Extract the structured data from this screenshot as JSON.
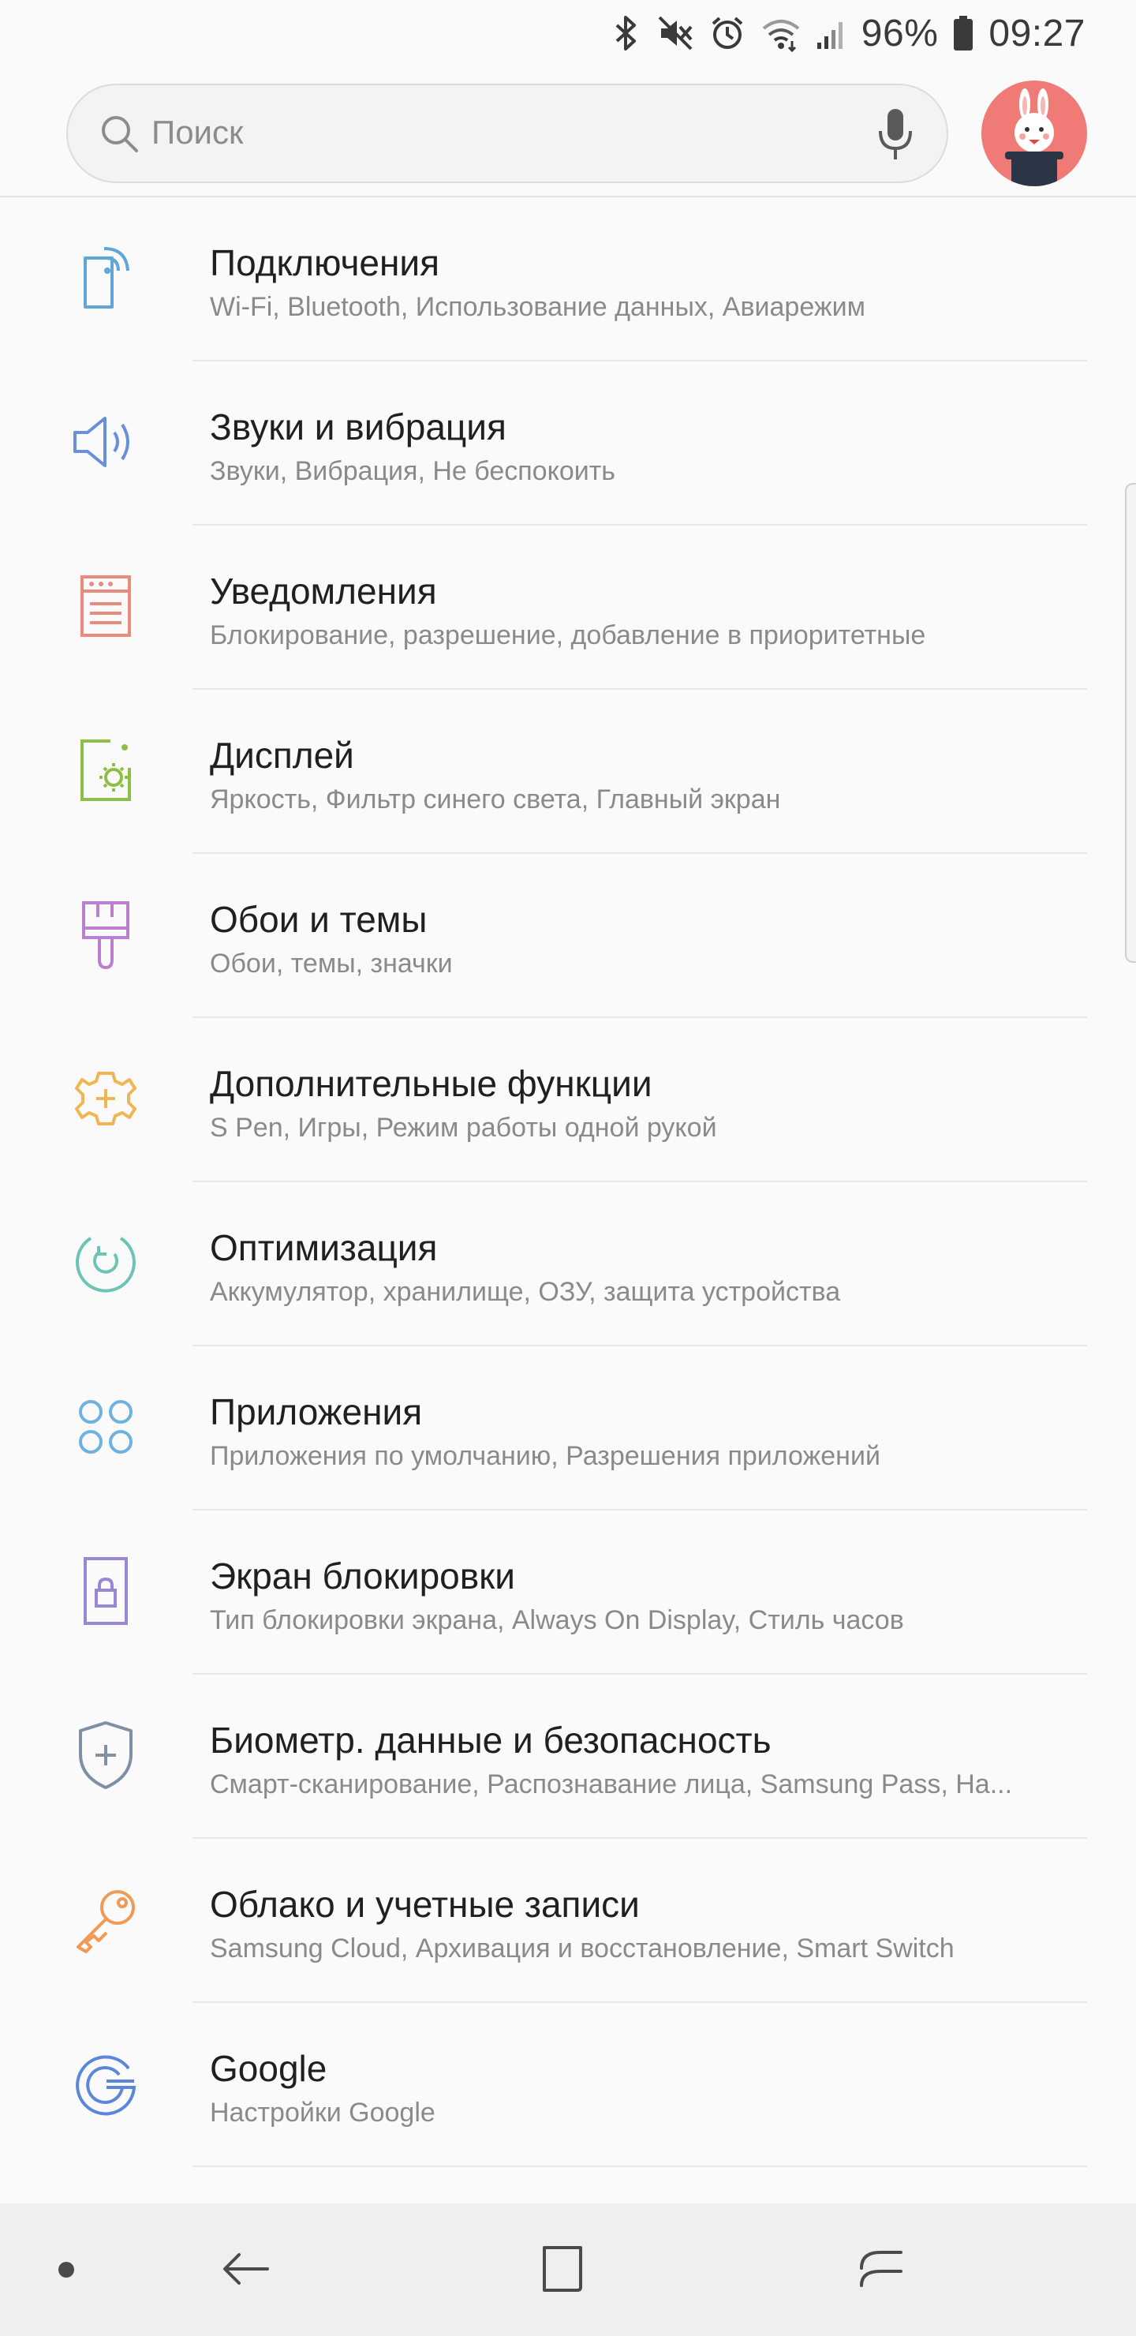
{
  "status_bar": {
    "battery": "96%",
    "time": "09:27",
    "icons": [
      "bluetooth-icon",
      "mute-icon",
      "alarm-icon",
      "wifi-icon",
      "signal-icon",
      "battery-icon"
    ]
  },
  "search": {
    "placeholder": "Поиск",
    "icons": [
      "search-icon",
      "mic-icon"
    ]
  },
  "accent_colors": {
    "connections": "#5fa6d9",
    "sounds": "#6a8fd8",
    "notifications": "#ea8b7d",
    "display": "#8cbf45",
    "wallpaper": "#bb7fd0",
    "advanced": "#f0b654",
    "optimization": "#6ec4b4",
    "apps": "#6fb2e0",
    "lock": "#9a86d6",
    "biometrics": "#7f8fa4",
    "cloud": "#f09a55",
    "google": "#5b87db"
  },
  "settings": [
    {
      "title": "Подключения",
      "subtitle": "Wi-Fi, Bluetooth, Использование данных, Авиарежим",
      "icon": "connections-icon"
    },
    {
      "title": "Звуки и вибрация",
      "subtitle": "Звуки, Вибрация, Не беспокоить",
      "icon": "speaker-icon"
    },
    {
      "title": "Уведомления",
      "subtitle": "Блокирование, разрешение, добавление в приоритетные",
      "icon": "notifications-icon"
    },
    {
      "title": "Дисплей",
      "subtitle": "Яркость, Фильтр синего света, Главный экран",
      "icon": "display-brightness-icon"
    },
    {
      "title": "Обои и темы",
      "subtitle": "Обои, темы, значки",
      "icon": "paintbrush-icon"
    },
    {
      "title": "Дополнительные функции",
      "subtitle": "S Pen, Игры, Режим работы одной рукой",
      "icon": "gear-plus-icon"
    },
    {
      "title": "Оптимизация",
      "subtitle": "Аккумулятор, хранилище, ОЗУ, защита устройства",
      "icon": "optimization-icon"
    },
    {
      "title": "Приложения",
      "subtitle": "Приложения по умолчанию, Разрешения приложений",
      "icon": "apps-grid-icon"
    },
    {
      "title": "Экран блокировки",
      "subtitle": "Тип блокировки экрана, Always On Display, Стиль часов",
      "icon": "lock-screen-icon"
    },
    {
      "title": "Биометр. данные и безопасность",
      "subtitle": "Смарт-сканирование, Распознавание лица, Samsung Pass, На...",
      "icon": "shield-plus-icon"
    },
    {
      "title": "Облако и учетные записи",
      "subtitle": "Samsung Cloud, Архивация и восстановление, Smart Switch",
      "icon": "key-icon"
    },
    {
      "title": "Google",
      "subtitle": "Настройки Google",
      "icon": "google-icon"
    }
  ],
  "nav_bar": {
    "icons": [
      "dot-icon",
      "back-icon",
      "home-icon",
      "recents-icon"
    ]
  }
}
